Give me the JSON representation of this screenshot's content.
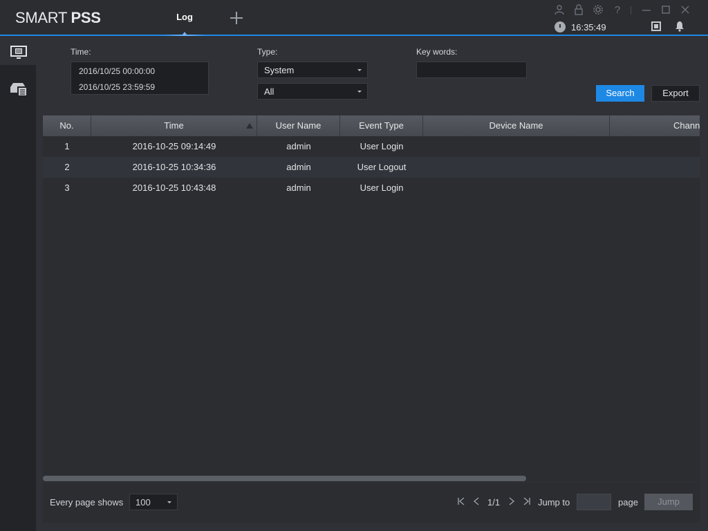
{
  "app": {
    "logo_thin": "SMART",
    "logo_bold": "PSS",
    "clock": "16:35:49"
  },
  "tabs": [
    {
      "label": "Log",
      "active": true
    }
  ],
  "icons": {
    "user": "user-icon",
    "lock": "lock-icon",
    "settings": "gear-icon",
    "help": "help-icon",
    "minimize": "minimize-icon",
    "maximize": "maximize-icon",
    "close": "close-icon",
    "clock": "clock-icon",
    "chip": "chip-icon",
    "bell": "bell-icon"
  },
  "filters": {
    "time_label": "Time:",
    "time_start": "2016/10/25 00:00:00",
    "time_end": "2016/10/25 23:59:59",
    "type_label": "Type:",
    "type_value": "System",
    "subtype_value": "All",
    "keywords_label": "Key words:",
    "keywords_value": "",
    "search_label": "Search",
    "export_label": "Export"
  },
  "table": {
    "columns": [
      "No.",
      "Time",
      "User Name",
      "Event Type",
      "Device Name",
      "Chann"
    ],
    "rows": [
      [
        "1",
        "2016-10-25 09:14:49",
        "admin",
        "User Login",
        "",
        ""
      ],
      [
        "2",
        "2016-10-25 10:34:36",
        "admin",
        "User Logout",
        "",
        ""
      ],
      [
        "3",
        "2016-10-25 10:43:48",
        "admin",
        "User Login",
        "",
        ""
      ]
    ]
  },
  "pagination": {
    "every_page_label": "Every page shows",
    "page_size": "100",
    "page_info": "1/1",
    "jump_to_label": "Jump to",
    "page_label": "page",
    "jump_label": "Jump",
    "jump_value": ""
  },
  "colors": {
    "accent": "#1e88e5",
    "background": "#2f3136",
    "nav": "#222428"
  }
}
